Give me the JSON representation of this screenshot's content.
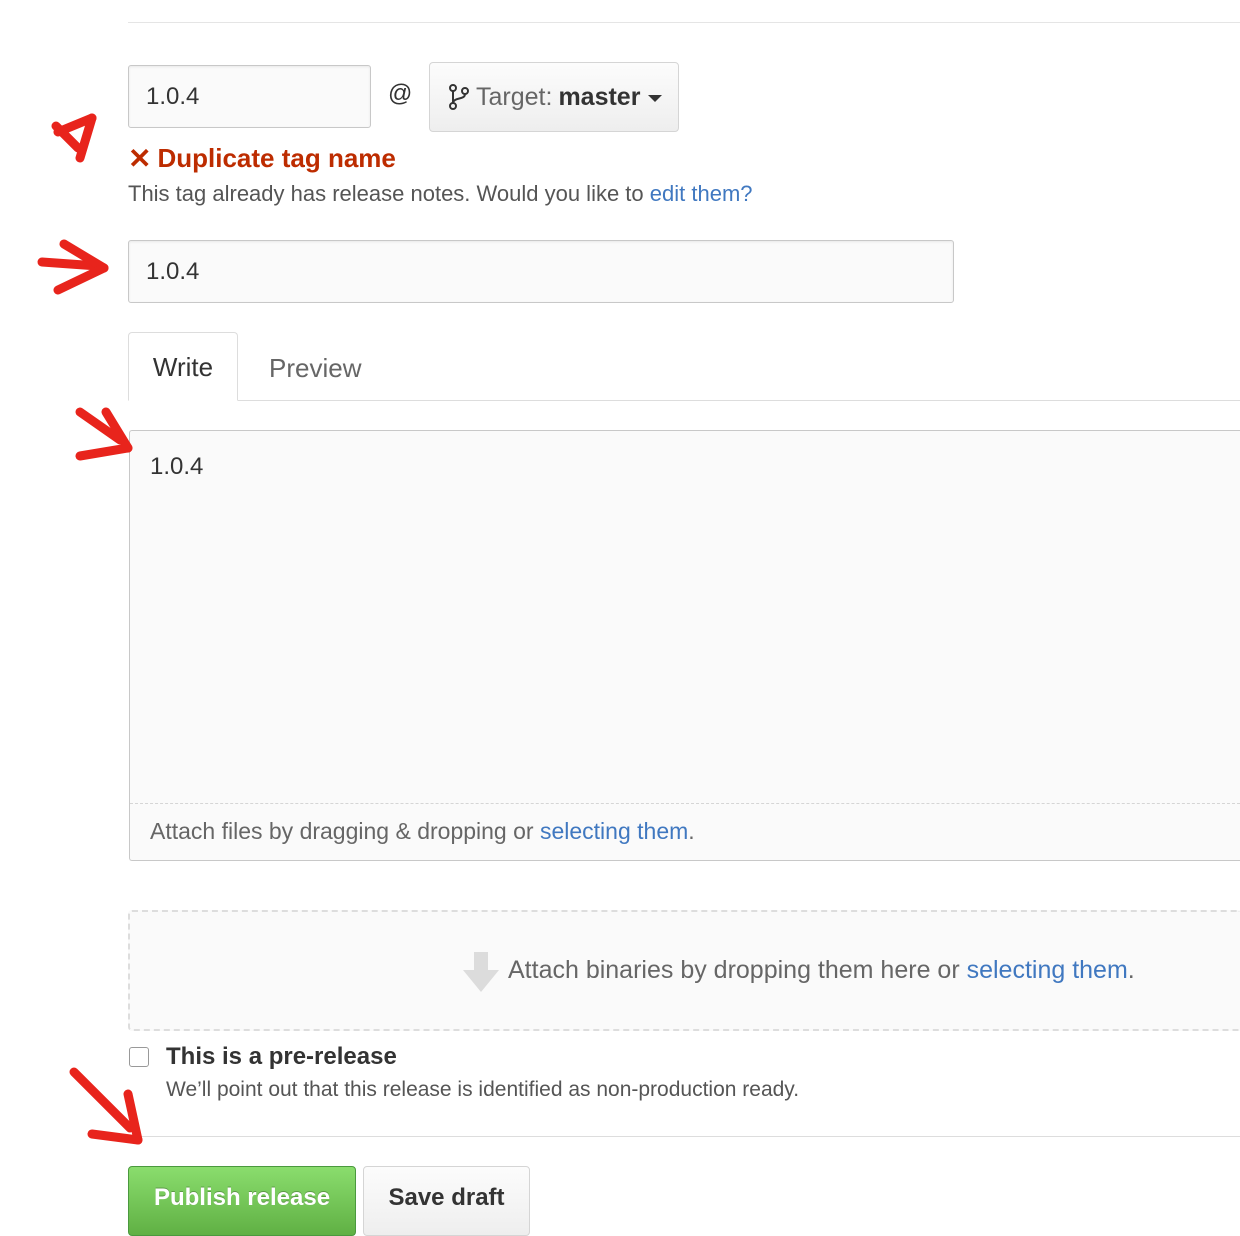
{
  "tag": {
    "version_value": "1.0.4",
    "at_symbol": "@",
    "target_label": "Target:",
    "target_branch": "master"
  },
  "error": {
    "icon": "x-icon",
    "message": "Duplicate tag name",
    "help_text": "This tag already has release notes. Would you like to ",
    "help_link": "edit them?"
  },
  "release_title": {
    "value": "1.0.4"
  },
  "editor": {
    "tabs": [
      {
        "label": "Write",
        "active": true
      },
      {
        "label": "Preview",
        "active": false
      }
    ],
    "body": "1.0.4",
    "attach_text": "Attach files by dragging & dropping or ",
    "attach_link": "selecting them",
    "attach_period": "."
  },
  "binaries": {
    "icon": "arrow-down-icon",
    "text": "Attach binaries by dropping them here or ",
    "link": "selecting them",
    "period": "."
  },
  "prerelease": {
    "checked": false,
    "label": "This is a pre-release",
    "note": "We’ll point out that this release is identified as non-production ready."
  },
  "actions": {
    "publish_label": "Publish release",
    "draft_label": "Save draft"
  },
  "colors": {
    "error": "#bd2c00",
    "link": "#4078c0",
    "publish": "#60b044",
    "annotation_arrow": "#e8241c"
  }
}
